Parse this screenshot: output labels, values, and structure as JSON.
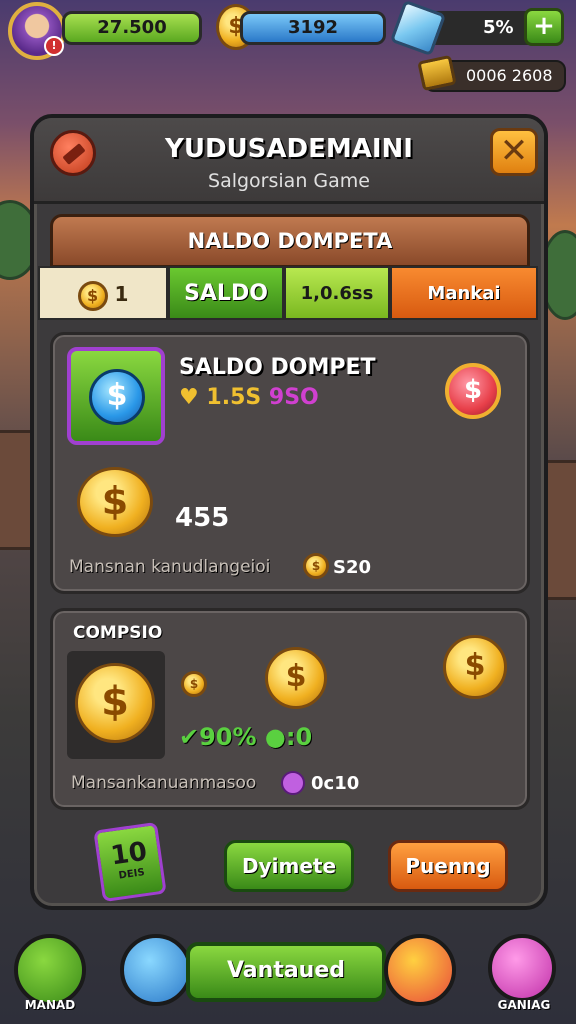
{
  "top_bar": {
    "gold_amount": "27.500",
    "blue_amount": "3192",
    "gem_percent": "5%",
    "gold_pill": "0006 2608",
    "avatar_badge": "!"
  },
  "panel": {
    "title": "YUDUSADEMAINI",
    "subtitle": "Salgorsian Game",
    "close_label": "✕"
  },
  "banner": "NALDO DOMPETA",
  "tabs": {
    "coin_value": "1",
    "saldo_label": "SALDO",
    "value_label": "1,0.6ss",
    "mankai_label": "Mankai"
  },
  "card1": {
    "title": "SALDO DOMPET",
    "stat_a": "1.5S",
    "stat_b": "9SO",
    "big_value": "455",
    "footer_text": "Mansnan kanudlangeioi",
    "footer_value": "S20"
  },
  "card2": {
    "title": "COMPSIO",
    "green_stat_a": "90%",
    "green_stat_b": ":0",
    "footer_text": "Mansankanuanmasoo",
    "timer": "0c10"
  },
  "bonus_card": {
    "number": "10",
    "label": "DEIS"
  },
  "buttons": {
    "green": "Dyimete",
    "orange": "Puenng"
  },
  "bottom_nav": {
    "left_label": "MANAD",
    "main_label": "Vantaued",
    "right_label": "GANIAG"
  },
  "colors": {
    "green_accent": "#5aa820",
    "orange_accent": "#d85a10",
    "gold": "#f0b020",
    "purple_frame": "#a040d0"
  },
  "icons": [
    "avatar",
    "gold-coin-icon",
    "gem-icon",
    "plus-icon",
    "chest-icon",
    "hammer-icon",
    "close-icon",
    "wallet-icon",
    "pink-coin-icon",
    "timer-icon",
    "chest-nav-icon",
    "broom-icon",
    "spin-icon",
    "trophy-icon"
  ]
}
